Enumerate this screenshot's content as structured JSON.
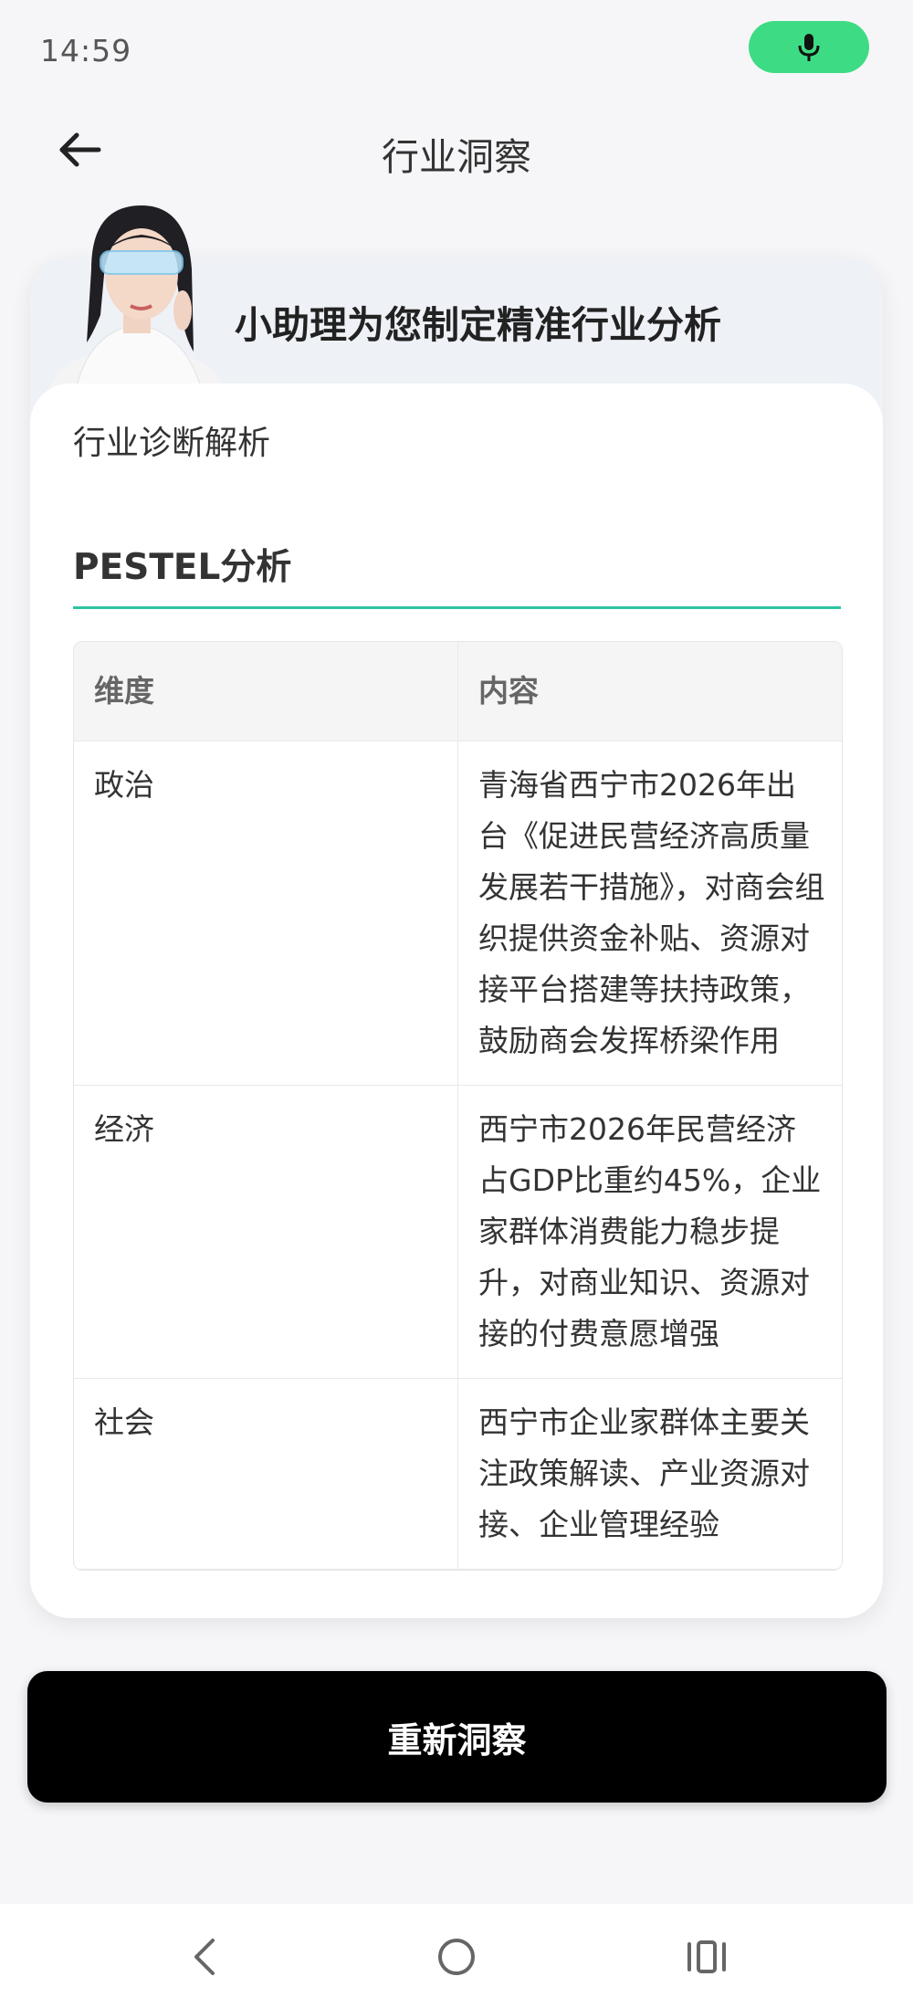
{
  "status": {
    "time": "14:59"
  },
  "header": {
    "title": "行业洞察"
  },
  "banner": {
    "title": "小助理为您制定精准行业分析"
  },
  "card": {
    "section_title": "行业诊断解析",
    "pestel_title": "PESTEL分析",
    "table": {
      "columns": [
        "维度",
        "内容"
      ],
      "rows": [
        {
          "dimension": "政治",
          "content": "青海省西宁市2026年出台《促进民营经济高质量发展若干措施》，对商会组织提供资金补贴、资源对接平台搭建等扶持政策，鼓励商会发挥桥梁作用"
        },
        {
          "dimension": "经济",
          "content": "西宁市2026年民营经济占GDP比重约45%，企业家群体消费能力稳步提升，对商业知识、资源对接的付费意愿增强"
        },
        {
          "dimension": "社会",
          "content": "西宁市企业家群体主要关注政策解读、产业资源对接、企业管理经验"
        }
      ]
    }
  },
  "actions": {
    "reinsight_label": "重新洞察"
  },
  "colors": {
    "accent": "#2ec4a0",
    "mic": "#3ddc84",
    "button": "#000000"
  }
}
